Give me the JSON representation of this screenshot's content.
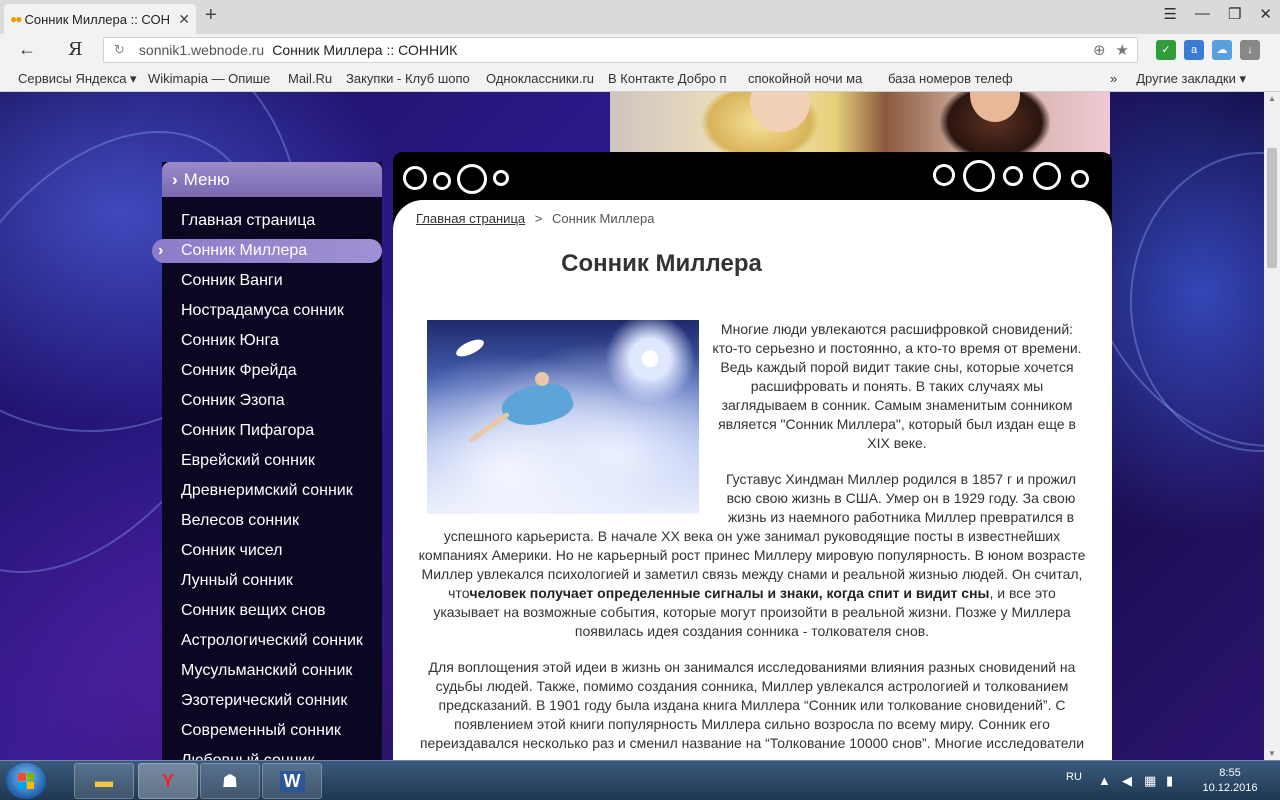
{
  "browser": {
    "tab_title": "Сонник Миллера :: СОНН",
    "url_host": "sonnik1.webnode.ru",
    "url_title": "Сонник Миллера :: СОННИК",
    "yandex_letter": "Я"
  },
  "bookmarks": [
    {
      "label": "Сервисы Яндекса ▾"
    },
    {
      "label": "Wikimapia — Опише"
    },
    {
      "label": "Mail.Ru"
    },
    {
      "label": "Закупки - Клуб шопо"
    },
    {
      "label": "Одноклассники.ru"
    },
    {
      "label": "В Контакте  Добро п"
    },
    {
      "label": "спокойной ночи ма"
    },
    {
      "label": "база номеров телеф"
    }
  ],
  "bookmarks_other": "Другие закладки ▾",
  "bookmarks_more": "»",
  "menu": {
    "title": "Меню",
    "items": [
      {
        "label": "Главная страница"
      },
      {
        "label": "Сонник Миллера"
      },
      {
        "label": "Сонник Ванги"
      },
      {
        "label": "Нострадамуса сонник"
      },
      {
        "label": "Сонник Юнга"
      },
      {
        "label": "Сонник Фрейда"
      },
      {
        "label": "Сонник Эзопа"
      },
      {
        "label": "Сонник Пифагора"
      },
      {
        "label": "Еврейский сонник"
      },
      {
        "label": "Древнеримский сонник"
      },
      {
        "label": "Велесов сонник"
      },
      {
        "label": "Сонник чисел"
      },
      {
        "label": "Лунный сонник"
      },
      {
        "label": "Сонник вещих снов"
      },
      {
        "label": "Астрологический сонник"
      },
      {
        "label": "Мусульманский сонник"
      },
      {
        "label": "Эзотерический сонник"
      },
      {
        "label": "Современный сонник"
      },
      {
        "label": "Любовный сонник"
      }
    ]
  },
  "breadcrumb": {
    "home": "Главная страница",
    "sep": ">",
    "current": "Сонник Миллера"
  },
  "article": {
    "title": "Сонник Миллера",
    "p1": "Многие люди увлекаются расшифровкой сновидений: кто-то серьезно и постоянно, а кто-то время от времени. Ведь каждый порой видит такие сны, которые хочется расшифровать и понять. В таких случаях мы заглядываем в сонник. Самым знаменитым сонником является \"Сонник Миллера\", который был издан еще в XIX веке.",
    "p2_a": "Густавус Хиндман Миллер родился в 1857 г и прожил всю свою жизнь в США. Умер он в 1929 году. За свою жизнь из наемного работника Миллер превратился в",
    "p2_b": "успешного карьериста. В начале XX века он уже занимал руководящие посты в известнейших компаниях Америки. Но не карьерный рост принес Миллеру мировую популярность. В юном возрасте Миллер увлекался психологией и заметил связь между снами и реальной жизнью людей. Он считал, что",
    "p2_bold": "человек получает определенные сигналы и знаки, когда спит и видит сны",
    "p2_c": ", и все это указывает на возможные события, которые могут произойти в реальной жизни. Позже у Миллера появилась идея создания сонника - толкователя снов.",
    "p3": "Для воплощения этой идеи в жизнь он занимался исследованиями влияния разных сновидений на судьбы людей. Также, помимо создания сонника, Миллер увлекался астрологией и толкованием предсказаний. В 1901 году была издана книга Миллера “Сонник или толкование сновидений”. С появлением этой книги популярность Миллера сильно возросла по всему миру. Сонник его переиздавался несколько раз и сменил название на “Толкование 10000 снов”. Многие исследователи"
  },
  "taskbar": {
    "lang": "RU",
    "time": "8:55",
    "date": "10.12.2016"
  }
}
